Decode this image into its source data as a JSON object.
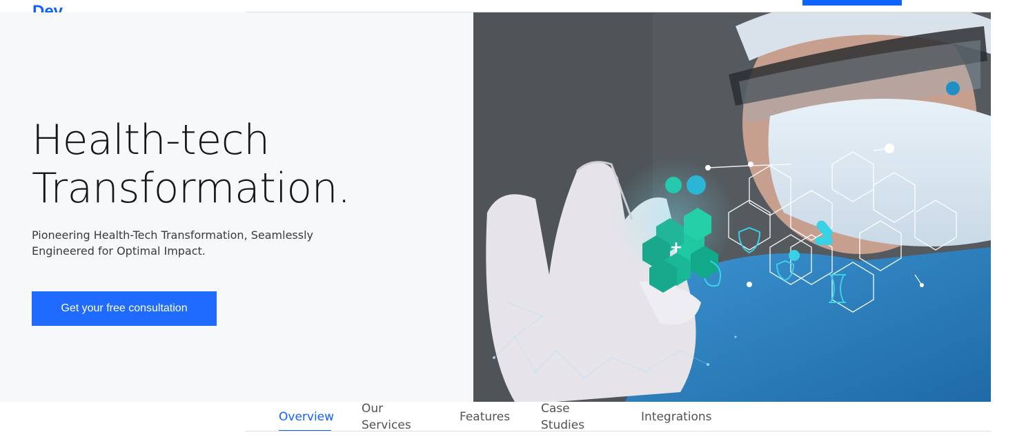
{
  "header": {
    "logo": "Dev"
  },
  "hero": {
    "title_line1": "Health-tech",
    "title_line2": "Transformation.",
    "subtitle": "Pioneering Health-Tech Transformation, Seamlessly Engineered for Optimal Impact.",
    "cta_label": "Get your free consultation",
    "image_alt": "Scientist in mask and gloves holding glowing hexagonal medical icons"
  },
  "tabs": [
    {
      "label": "Overview",
      "active": true
    },
    {
      "label": "Our Services",
      "active": false
    },
    {
      "label": "Features",
      "active": false
    },
    {
      "label": "Case Studies",
      "active": false
    },
    {
      "label": "Integrations",
      "active": false
    }
  ],
  "colors": {
    "accent": "#0f62fe",
    "cta": "#1f6bff",
    "hero_bg": "#f7f8fa",
    "text": "#161616"
  }
}
